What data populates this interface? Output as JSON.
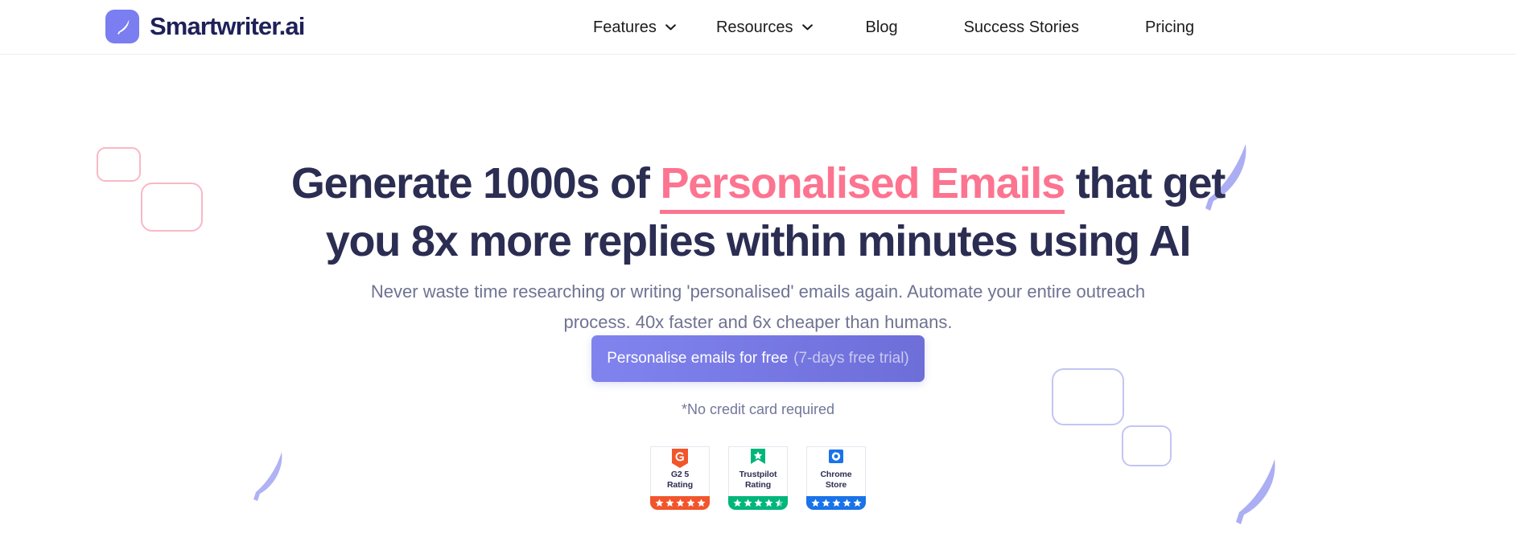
{
  "header": {
    "brand": {
      "name": "Smartwriter.ai",
      "logo_icon": "feather-icon",
      "logo_bg": "#7a7ef0"
    },
    "nav": [
      {
        "label": "Features",
        "has_dropdown": true,
        "icon": "chevron-down-icon"
      },
      {
        "label": "Resources",
        "has_dropdown": true,
        "icon": "chevron-down-icon"
      },
      {
        "label": "Blog",
        "has_dropdown": false
      },
      {
        "label": "Success Stories",
        "has_dropdown": false
      },
      {
        "label": "Pricing",
        "has_dropdown": false
      }
    ]
  },
  "hero": {
    "headline": {
      "part1": "Generate 1000s of ",
      "accent": "Personalised Emails",
      "part2": " that get you 8x more replies within minutes using AI",
      "accent_color": "#fc7490",
      "text_color": "#2b2d52"
    },
    "subheading": "Never waste time researching or writing 'personalised' emails again. Automate your entire outreach process. 40x faster and 6x cheaper than humans.",
    "cta": {
      "label": "Personalise emails for free",
      "sublabel": "(7-days free trial)",
      "bg_color": "#7779e6"
    },
    "note": "*No credit card required"
  },
  "badges": [
    {
      "logo_icon": "g2-icon",
      "label_line1": "G2 5",
      "label_line2": "Rating",
      "color": "#f2552c",
      "stars": 5,
      "half_star": false
    },
    {
      "logo_icon": "trustpilot-icon",
      "label_line1": "Trustpilot",
      "label_line2": "Rating",
      "color": "#00b67a",
      "stars": 4,
      "half_star": true
    },
    {
      "logo_icon": "chrome-store-icon",
      "label_line1": "Chrome",
      "label_line2": "Store",
      "color": "#1a73e8",
      "stars": 5,
      "half_star": false
    }
  ],
  "decorations": {
    "pink_square_color": "#f9b8c7",
    "purple_square_color": "#c3c5f3",
    "feather_color": "#9a9cf0"
  }
}
